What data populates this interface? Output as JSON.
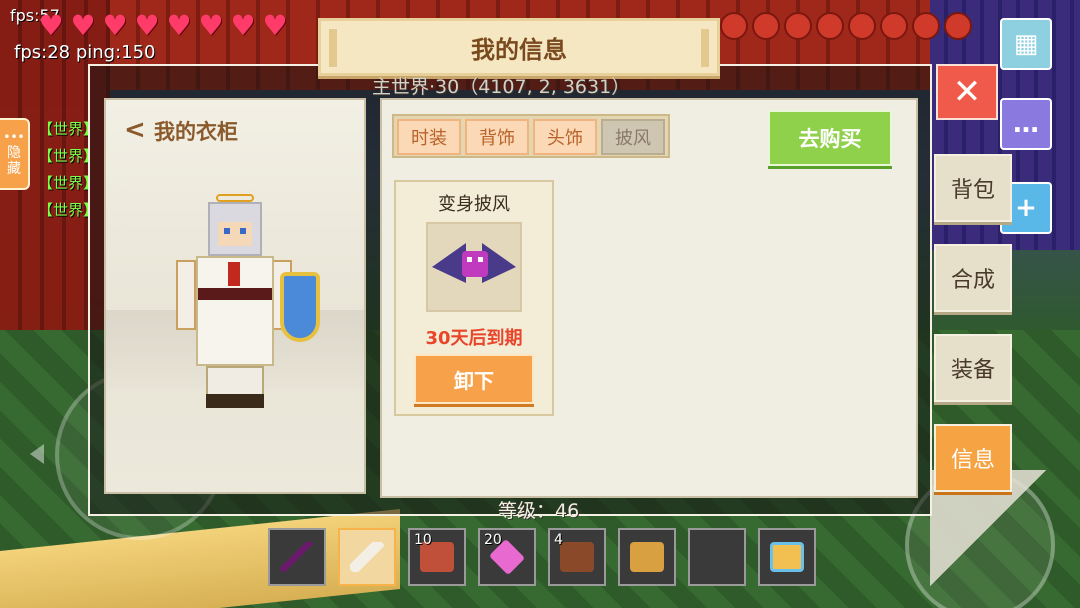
{
  "hud": {
    "fps": "fps:57",
    "fps_ping": "fps:28 ping:150",
    "hearts_count": 8,
    "food_count": 8,
    "hide_tab_label": "隐藏",
    "chat_lines": [
      "【世界】",
      "【世界】",
      "【世界】",
      "【世界】"
    ],
    "level_text": "等级：46"
  },
  "dialog": {
    "title": "我的信息",
    "coords": "主世界·30（4107, 2, 3631）",
    "wardrobe": {
      "title": "我的衣柜"
    },
    "tabs": [
      {
        "label": "时装",
        "active": false
      },
      {
        "label": "背饰",
        "active": false
      },
      {
        "label": "头饰",
        "active": false
      },
      {
        "label": "披风",
        "active": true
      }
    ],
    "buy_button": "去购买",
    "item": {
      "name": "变身披风",
      "expiry": "30天后到期",
      "action": "卸下"
    }
  },
  "side_menu": [
    {
      "label": "背包",
      "active": false
    },
    {
      "label": "合成",
      "active": false
    },
    {
      "label": "装备",
      "active": false
    },
    {
      "label": "信息",
      "active": true
    }
  ],
  "hotbar": [
    {
      "icon": "wand-icon",
      "qty": "",
      "selected": false
    },
    {
      "icon": "bone-icon",
      "qty": "",
      "selected": true
    },
    {
      "icon": "meat-icon",
      "qty": "10",
      "selected": false
    },
    {
      "icon": "gem-icon",
      "qty": "20",
      "selected": false
    },
    {
      "icon": "hide-icon",
      "qty": "4",
      "selected": false
    },
    {
      "icon": "bread-icon",
      "qty": "",
      "selected": false
    },
    {
      "icon": "",
      "qty": "",
      "selected": false
    },
    {
      "icon": "mug-icon",
      "qty": "",
      "selected": false
    }
  ],
  "colors": {
    "accent_orange": "#f6a443",
    "buy_green": "#8fd14a",
    "close_red": "#ef5a4a",
    "expiry_red": "#e8452a"
  }
}
